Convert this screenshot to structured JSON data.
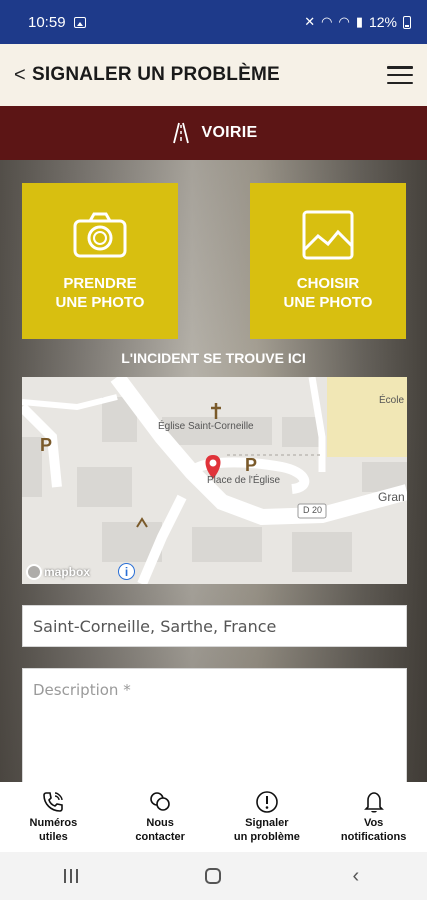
{
  "status_bar": {
    "time": "10:59",
    "battery": "12%"
  },
  "header": {
    "back_glyph": "<",
    "title": "SIGNALER UN PROBLÈME"
  },
  "category": {
    "label": "VOIRIE",
    "icon": "road-icon"
  },
  "photo_buttons": [
    {
      "label_line1": "PRENDRE",
      "label_line2": "UNE PHOTO",
      "icon": "camera-icon"
    },
    {
      "label_line1": "CHOISIR",
      "label_line2": "UNE PHOTO",
      "icon": "image-icon"
    }
  ],
  "incident_label": "L'INCIDENT SE TROUVE ICI",
  "map": {
    "labels": {
      "church": "Église Saint-Corneille",
      "place": "Place de l'Église",
      "road": "D 20",
      "street": "Gran",
      "ecole": "École",
      "parking": "P"
    },
    "attribution": "mapbox",
    "info": "i"
  },
  "location_value": "Saint-Corneille, Sarthe, France",
  "description_placeholder": "Description *",
  "bottom_nav": [
    {
      "line1": "Numéros",
      "line2": "utiles",
      "icon": "phone-icon"
    },
    {
      "line1": "Nous",
      "line2": "contacter",
      "icon": "chat-icon"
    },
    {
      "line1": "Signaler",
      "line2": "un problème",
      "icon": "alert-icon"
    },
    {
      "line1": "Vos",
      "line2": "notifications",
      "icon": "bell-icon"
    }
  ],
  "colors": {
    "status_bar": "#1e3a8a",
    "header_bg": "#f6f1e7",
    "category_bg": "#5c1515",
    "accent_yellow": "#d8bf10",
    "map_pin": "#e0333a"
  }
}
